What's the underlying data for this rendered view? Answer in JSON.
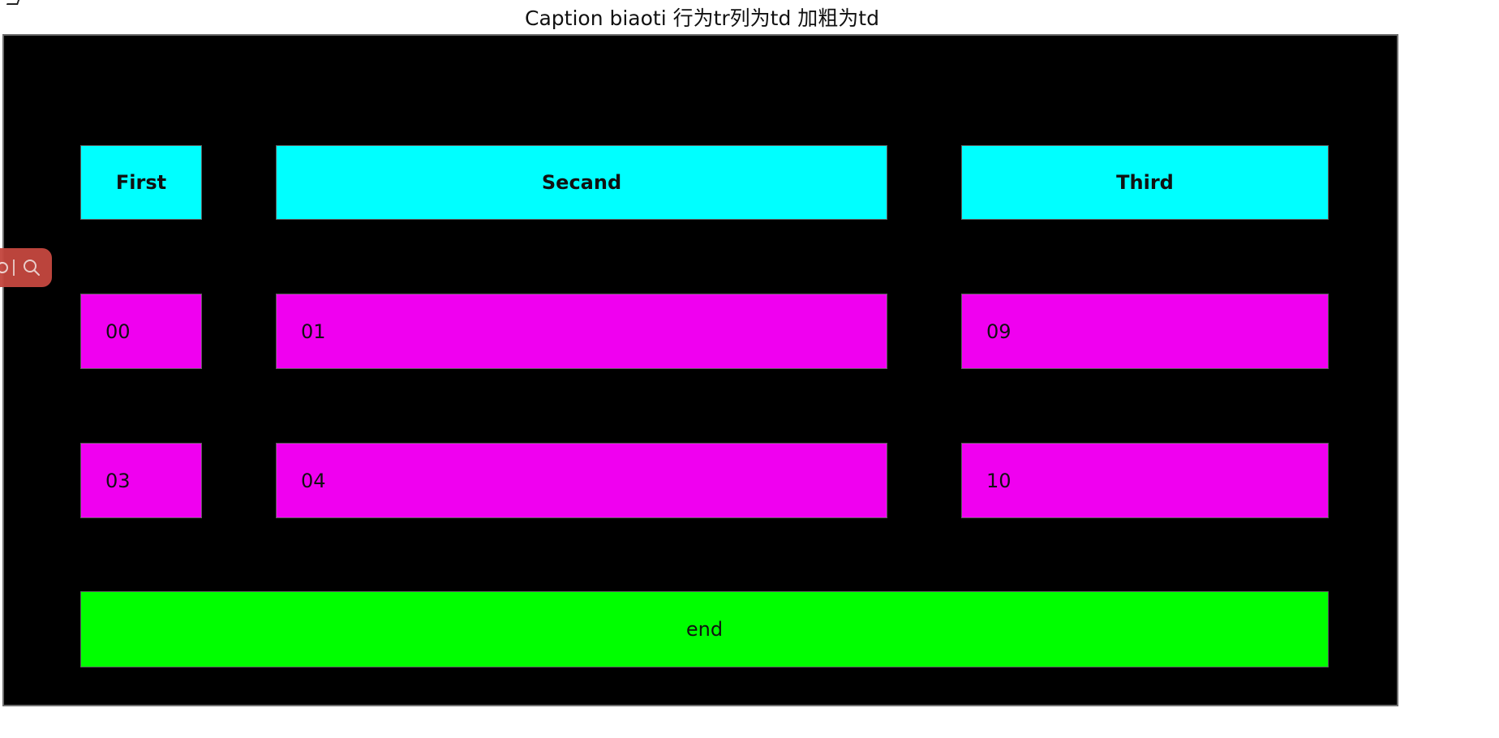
{
  "caption": "Caption biaoti 行为tr列为td 加粗为td",
  "table": {
    "headers": [
      "First",
      "Secand",
      "Third"
    ],
    "rows": [
      [
        "00",
        "01",
        "09"
      ],
      [
        "03",
        "04",
        "10"
      ]
    ],
    "footer": "end"
  },
  "colors": {
    "frame_background": "#000000",
    "header_cell": "#00ffff",
    "data_cell": "#f000f0",
    "footer_cell": "#00ff00",
    "floating_tool": "#c3473f"
  },
  "icons": {
    "floating_left": "circle-icon",
    "floating_right": "search-icon"
  }
}
